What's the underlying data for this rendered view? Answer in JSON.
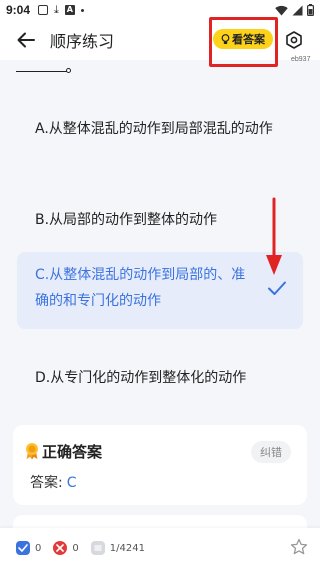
{
  "status_bar": {
    "time": "9:04"
  },
  "header": {
    "title": "顺序练习",
    "show_answer_label": "看答案",
    "question_id": "eb937"
  },
  "options": [
    {
      "label": "A.从整体混乱的动作到局部混乱的动作",
      "selected": false
    },
    {
      "label": "B.从局部的动作到整体的动作",
      "selected": false
    },
    {
      "label": "C.从整体混乱的动作到局部的、准确的和专门化的动作",
      "selected": true
    },
    {
      "label": "D.从专门化的动作到整体化的动作",
      "selected": false
    }
  ],
  "answer_card": {
    "title": "正确答案",
    "report_label": "纠错",
    "answer_prefix": "答案:",
    "answer_value": "C"
  },
  "bottom_bar": {
    "correct_count": "0",
    "wrong_count": "0",
    "progress": "1/4241"
  },
  "colors": {
    "accent": "#3a73e0",
    "highlight_yellow": "#fcd21b",
    "annotation_red": "#e02424"
  }
}
